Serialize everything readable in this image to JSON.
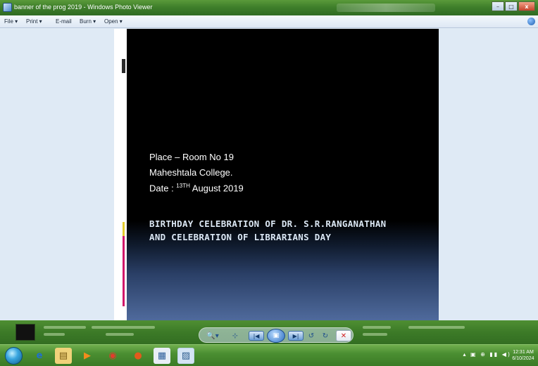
{
  "window": {
    "title": "banner of the prog 2019 - Windows Photo Viewer",
    "controls": {
      "minimize": "–",
      "maximize": "□",
      "close": "x"
    }
  },
  "menubar": {
    "items": [
      {
        "label": "File ▾"
      },
      {
        "label": "Print ▾"
      },
      {
        "label": "E-mail"
      },
      {
        "label": "Burn ▾"
      },
      {
        "label": "Open ▾"
      }
    ]
  },
  "slide": {
    "place": "Place – Room No 19",
    "college": "Maheshtala College.",
    "date_prefix": "Date : ",
    "date_day": "13",
    "date_sup": "TH",
    "date_rest": " August 2019",
    "headline_line1": "BIRTHDAY CELEBRATION OF DR. S.R.RANGANATHAN",
    "headline_line2": "AND CELEBRATION OF LIBRARIANS DAY",
    "bar_colors": {
      "yellow": "#e4cc2d",
      "magenta": "#d1166a"
    }
  },
  "playback": {
    "zoom": "🔍▾",
    "actual_size": "⊹",
    "previous": "|◀",
    "slideshow": "▣",
    "next": "▶|",
    "rotate_ccw": "↺",
    "rotate_cw": "↻",
    "delete": "✕"
  },
  "taskbar": {
    "apps": [
      {
        "icon": "internet-explorer-icon",
        "glyph": "e"
      },
      {
        "icon": "folder-icon",
        "glyph": "▤"
      },
      {
        "icon": "media-player-icon",
        "glyph": "▶"
      },
      {
        "icon": "chrome-icon",
        "glyph": "◉"
      },
      {
        "icon": "firefox-icon",
        "glyph": "●"
      },
      {
        "icon": "document-icon",
        "glyph": "▦"
      },
      {
        "icon": "photo-viewer-icon",
        "glyph": "▨"
      }
    ],
    "tray_icons": "▴ ▣ ⊕ ▮▮ ◀)",
    "clock_time": "12:31 AM",
    "clock_date": "6/10/2024"
  }
}
